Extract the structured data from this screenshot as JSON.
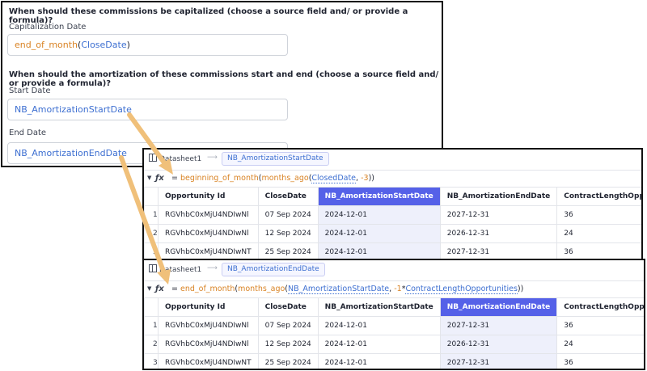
{
  "form": {
    "q1": "When should these commissions be capitalized (choose a source field and/ or provide a formula)?",
    "cap_label": "Capitalization Date",
    "cap_fn": "end_of_month",
    "cap_open": "(",
    "cap_arg": "CloseDate",
    "cap_close": ")",
    "q2": "When should the amortization of these commissions start and end (choose a source field and/ or provide a formula)?",
    "start_label": "Start Date",
    "start_value": "NB_AmortizationStartDate",
    "end_label": "End Date",
    "end_value": "NB_AmortizationEndDate"
  },
  "sheet1": {
    "tab": "Datasheet1",
    "column_chip": "NB_AmortizationStartDate",
    "formula": {
      "eq": "= ",
      "fn1": "beginning_of_month",
      "p1": "(",
      "fn2": "months_ago",
      "p2": "(",
      "arg": "ClosedDate",
      "comma": ", ",
      "num": "-3",
      "close": "))"
    },
    "headers": [
      "",
      "Opportunity Id",
      "CloseDate",
      "NB_AmortizationStartDate",
      "NB_AmortizationEndDate",
      "ContractLengthOpport"
    ],
    "rows": [
      [
        "1",
        "RGVhbC0xMjU4NDIwNl",
        "07 Sep 2024",
        "2024-12-01",
        "2027-12-31",
        "36"
      ],
      [
        "2",
        "RGVhbC0xMjU4NDIwNl",
        "12 Sep 2024",
        "2024-12-01",
        "2026-12-31",
        "24"
      ],
      [
        "3",
        "RGVhbC0xMjU4NDIwNT",
        "25 Sep 2024",
        "2024-12-01",
        "2027-12-31",
        "36"
      ]
    ]
  },
  "sheet2": {
    "tab": "Datasheet1",
    "column_chip": "NB_AmortizationEndDate",
    "formula": {
      "eq": "= ",
      "fn1": "end_of_month",
      "p1": "(",
      "fn2": "months_ago",
      "p2": "(",
      "arg": "NB_AmortizationStartDate",
      "comma": ", ",
      "num": "-1",
      "star": "*",
      "arg2": "ContractLengthOpportunities",
      "close": "))"
    },
    "headers": [
      "",
      "Opportunity Id",
      "CloseDate",
      "NB_AmortizationStartDate",
      "NB_AmortizationEndDate",
      "ContractLengthOpport"
    ],
    "rows": [
      [
        "1",
        "RGVhbC0xMjU4NDIwNl",
        "07 Sep 2024",
        "2024-12-01",
        "2027-12-31",
        "36"
      ],
      [
        "2",
        "RGVhbC0xMjU4NDIwNl",
        "12 Sep 2024",
        "2024-12-01",
        "2026-12-31",
        "24"
      ],
      [
        "3",
        "RGVhbC0xMjU4NDIwNT",
        "25 Sep 2024",
        "2024-12-01",
        "2027-12-31",
        "36"
      ]
    ]
  },
  "icons": {
    "tab": "datasheet-icon",
    "fx": "fx-icon",
    "arrow": "right-arrow-icon",
    "annotation": "orange-arrow-icon"
  },
  "colors": {
    "function": "#d98324",
    "field": "#3d6fd1",
    "highlight_header": "#5561e8",
    "highlight_cell": "#eef0fb",
    "annotation_arrow": "#f0c07a"
  }
}
